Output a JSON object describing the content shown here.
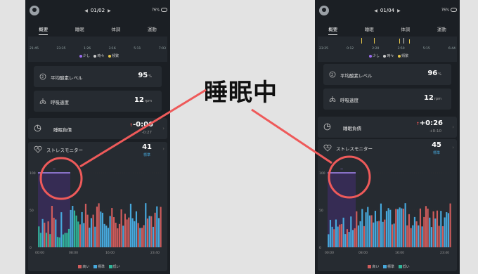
{
  "headline": "睡眠中",
  "colors": {
    "annotation": "#ee5a5a",
    "sleep_purple": "#9b6cf0",
    "high_red": "#d05c5c",
    "normal_blue": "#47a8dc",
    "low_green": "#2fb69a"
  },
  "phones": [
    {
      "date": "01/02",
      "battery": "76%",
      "tabs": [
        "概要",
        "睡眠",
        "体調",
        "運動"
      ],
      "timeline_times": [
        "21:45",
        "23:35",
        "1:26",
        "3:16",
        "5:11",
        "7:03"
      ],
      "timeline_legend": [
        "少し",
        "時々",
        "頻繁"
      ],
      "spo2_label": "平均酸素レベル",
      "spo2_value": "95",
      "spo2_unit": "%",
      "resp_label": "呼吸速度",
      "resp_value": "12",
      "resp_unit": "rpm",
      "debt_label": "睡眠負債",
      "debt_value": "-0:06",
      "debt_sub": "-0:27",
      "stress_label": "ストレスモニター",
      "stress_value": "41",
      "stress_level": "標準",
      "y_ticks": [
        "100",
        "50",
        "0"
      ],
      "x_ticks": [
        "00:00",
        "08:00",
        "16:00",
        "23:40"
      ],
      "legend": [
        "高い",
        "標準",
        "低い"
      ]
    },
    {
      "date": "01/04",
      "battery": "76%",
      "tabs": [
        "概要",
        "睡眠",
        "体調",
        "運動"
      ],
      "timeline_times": [
        "23:25",
        "0:12",
        "2:20",
        "3:50",
        "5:15",
        "6:44"
      ],
      "timeline_legend": [
        "少し",
        "時々",
        "頻繁"
      ],
      "spo2_label": "平均酸素レベル",
      "spo2_value": "96",
      "spo2_unit": "%",
      "resp_label": "呼吸速度",
      "resp_value": "12",
      "resp_unit": "rpm",
      "debt_label": "睡眠負債",
      "debt_value": "+0:26",
      "debt_sub": "+0:10",
      "stress_label": "ストレスモニター",
      "stress_value": "45",
      "stress_level": "標準",
      "y_ticks": [
        "100",
        "50",
        "0"
      ],
      "x_ticks": [
        "00:00",
        "08:00",
        "16:00",
        "23:40"
      ],
      "legend": [
        "高い",
        "標準",
        "低い"
      ]
    }
  ]
}
